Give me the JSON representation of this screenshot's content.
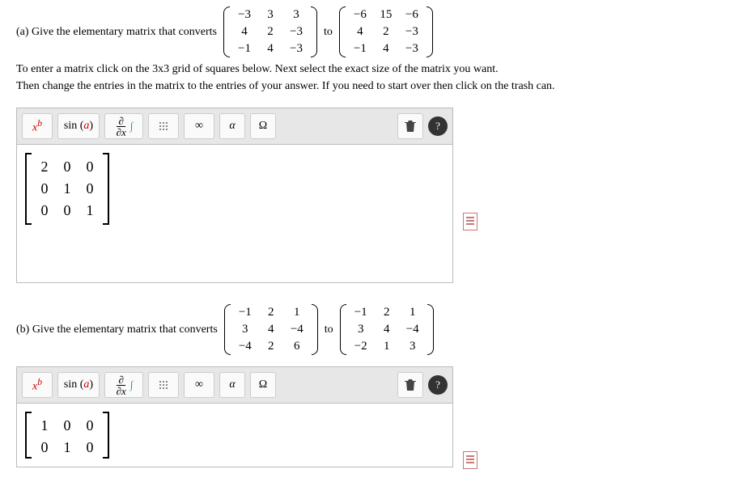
{
  "part_a": {
    "prefix": "(a) Give the elementary matrix that converts",
    "matrix_from": [
      [
        "−3",
        "3",
        "3"
      ],
      [
        "4",
        "2",
        "−3"
      ],
      [
        "−1",
        "4",
        "−3"
      ]
    ],
    "to_word": "to",
    "matrix_to": [
      [
        "−6",
        "15",
        "−6"
      ],
      [
        "4",
        "2",
        "−3"
      ],
      [
        "−1",
        "4",
        "−3"
      ]
    ],
    "instructions_line1": "To enter a matrix click on the 3x3 grid of squares below. Next select the exact size of the matrix you want.",
    "instructions_line2": "Then change the entries in the matrix to the entries of your answer. If you need to start over then click on the trash can.",
    "answer": [
      [
        "2",
        "0",
        "0"
      ],
      [
        "0",
        "1",
        "0"
      ],
      [
        "0",
        "0",
        "1"
      ]
    ]
  },
  "part_b": {
    "prefix": "(b) Give the elementary matrix that converts",
    "matrix_from": [
      [
        "−1",
        "2",
        "1"
      ],
      [
        "3",
        "4",
        "−4"
      ],
      [
        "−4",
        "2",
        "6"
      ]
    ],
    "to_word": "to",
    "matrix_to": [
      [
        "−1",
        "2",
        "1"
      ],
      [
        "3",
        "4",
        "−4"
      ],
      [
        "−2",
        "1",
        "3"
      ]
    ],
    "answer": [
      [
        "1",
        "0",
        "0"
      ],
      [
        "0",
        "1",
        "0"
      ]
    ]
  },
  "toolbar": {
    "exp_base": "x",
    "exp_sup": "b",
    "sin_label": "sin",
    "sin_arg": "a",
    "frac_num": "∂",
    "frac_den": "∂x",
    "infinity": "∞",
    "alpha": "α",
    "omega": "Ω",
    "trash_icon": "trash-icon",
    "help": "?"
  }
}
